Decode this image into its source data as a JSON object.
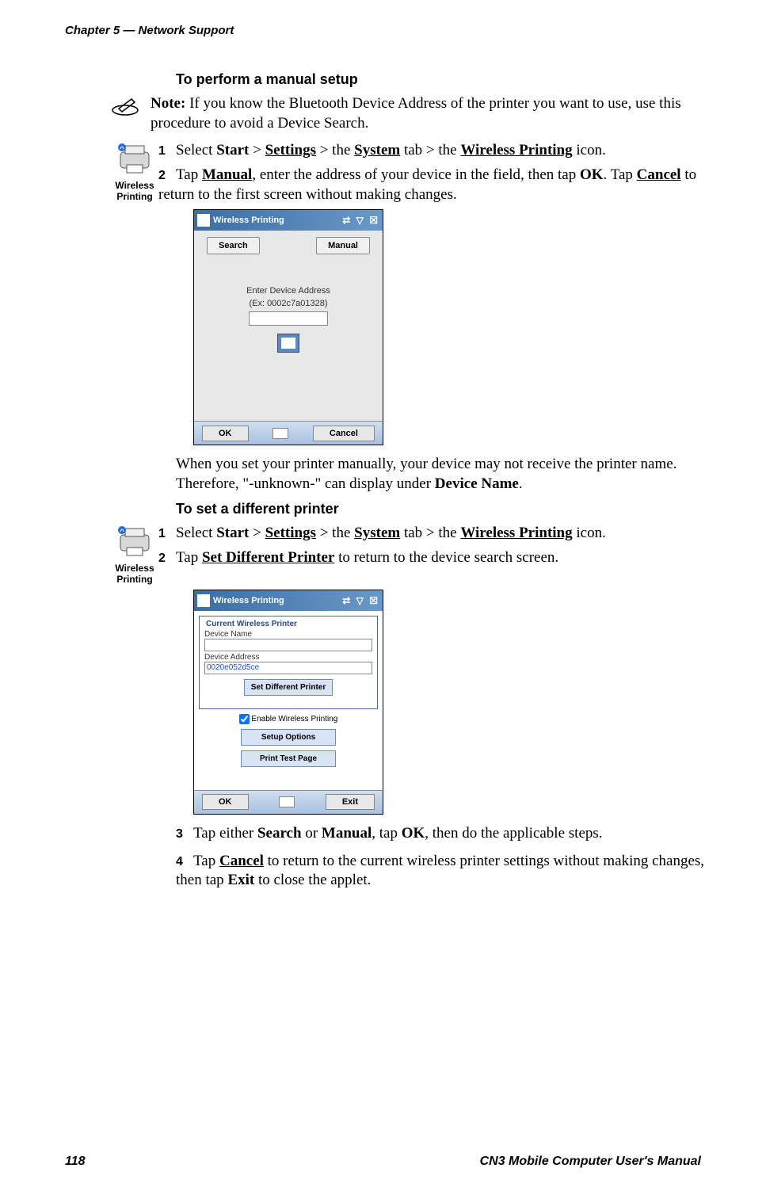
{
  "header": {
    "chapter": "Chapter 5 — Network Support"
  },
  "footer": {
    "page": "118",
    "manual": "CN3 Mobile Computer User's Manual"
  },
  "section1": {
    "heading": "To perform a manual setup",
    "note_bold": "Note:",
    "note_text": " If you know the Bluetooth Device Address of the printer you want to use, use this procedure to avoid a Device Search.",
    "printer_label": "Wireless Printing",
    "step1_num": "1",
    "step1_a": "Select ",
    "step1_start": "Start",
    "step1_b": " > ",
    "step1_settings": "Settings",
    "step1_c": " > the ",
    "step1_system": "System",
    "step1_d": " tab > the ",
    "step1_wp": "Wireless Printing",
    "step1_e": " icon.",
    "step2_num": "2",
    "step2_a": "Tap ",
    "step2_manual": "Manual",
    "step2_b": ", enter the address of your device in the field, then tap ",
    "step2_ok": "OK",
    "step2_c": ". Tap ",
    "step2_cancel": "Cancel",
    "step2_d": " to return to the first screen without making changes.",
    "after_a": "When you set your printer manually, your device may not receive the printer name. Therefore, \"-unknown-\" can display under ",
    "after_dn": "Device Name",
    "after_b": "."
  },
  "screenshot1": {
    "title": "Wireless Printing",
    "search": "Search",
    "manual": "Manual",
    "enter1": "Enter Device Address",
    "enter2": "(Ex: 0002c7a01328)",
    "ok": "OK",
    "cancel": "Cancel"
  },
  "section2": {
    "heading": "To set a different printer",
    "printer_label": "Wireless Printing",
    "step1_num": "1",
    "step1_a": "Select ",
    "step1_start": "Start",
    "step1_b": " > ",
    "step1_settings": "Settings",
    "step1_c": " > the ",
    "step1_system": "System",
    "step1_d": " tab > the ",
    "step1_wp": "Wireless Printing",
    "step1_e": " icon.",
    "step2_num": "2",
    "step2_a": "Tap ",
    "step2_sdp": "Set Different Printer",
    "step2_b": " to return to the device search screen.",
    "step3_num": "3",
    "step3_a": "Tap either ",
    "step3_search": "Search",
    "step3_b": " or ",
    "step3_manual": "Manual",
    "step3_c": ", tap ",
    "step3_ok": "OK",
    "step3_d": ", then do the applicable steps.",
    "step4_num": "4",
    "step4_a": "Tap ",
    "step4_cancel": "Cancel",
    "step4_b": " to return to the current wireless printer settings without making changes, then tap ",
    "step4_exit": "Exit",
    "step4_c": " to close the applet."
  },
  "screenshot2": {
    "title": "Wireless Printing",
    "group": "Current Wireless Printer",
    "devname_label": "Device Name",
    "devaddr_label": "Device Address",
    "devaddr_value": "0020e052d5ce",
    "setdiff": "Set Different Printer",
    "enable": "Enable Wireless Printing",
    "setup": "Setup Options",
    "printtest": "Print Test Page",
    "ok": "OK",
    "exit": "Exit"
  }
}
